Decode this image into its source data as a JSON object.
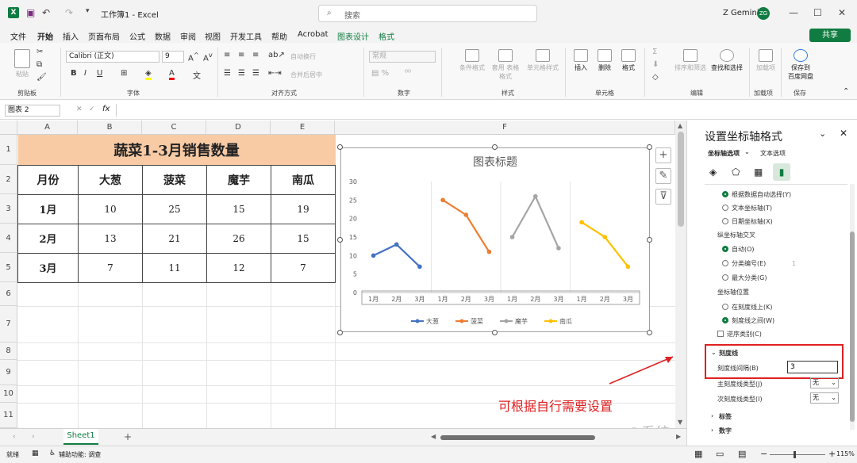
{
  "titlebar": {
    "file_title": "工作簿1 - Excel",
    "search": "搜索",
    "user": "Z Gemini",
    "avatar": "ZG"
  },
  "menu": [
    "文件",
    "开始",
    "插入",
    "页面布局",
    "公式",
    "数据",
    "审阅",
    "视图",
    "开发工具",
    "帮助",
    "Acrobat",
    "图表设计",
    "格式"
  ],
  "share": "共享",
  "ribbon": {
    "paste": "粘贴",
    "font_name": "Calibri (正文)",
    "font_size": "9",
    "wrap": "自动换行",
    "merge": "合并后居中",
    "numfmt": "常规",
    "cond": "条件格式",
    "tablefmt": "套用\n表格格式",
    "cellstyle": "单元格样式",
    "insert": "插入",
    "delete": "删除",
    "format": "格式",
    "sortfilter": "排序和筛选",
    "findsel": "查找和选择",
    "addin": "加载项",
    "save1": "保存到",
    "save2": "百度网盘",
    "groups": [
      "剪贴板",
      "字体",
      "对齐方式",
      "数字",
      "样式",
      "单元格",
      "编辑",
      "加载项",
      "保存"
    ]
  },
  "formula": {
    "name": "图表 2",
    "fx": "fx"
  },
  "columns": [
    "A",
    "B",
    "C",
    "D",
    "E",
    "F"
  ],
  "rows": [
    "1",
    "2",
    "3",
    "4",
    "5",
    "6",
    "7",
    "8",
    "9",
    "10",
    "11"
  ],
  "table": {
    "title": "蔬菜1-3月销售数量",
    "headers": [
      "月份",
      "大葱",
      "菠菜",
      "魔芋",
      "南瓜"
    ],
    "data": [
      [
        "1月",
        "10",
        "25",
        "15",
        "19"
      ],
      [
        "2月",
        "13",
        "21",
        "26",
        "15"
      ],
      [
        "3月",
        "7",
        "11",
        "12",
        "7"
      ]
    ]
  },
  "chart_data": {
    "type": "line",
    "title": "图表标题",
    "categories": [
      "1月",
      "2月",
      "3月"
    ],
    "ylim": [
      0,
      30
    ],
    "yticks": [
      "0",
      "5",
      "10",
      "15",
      "20",
      "25",
      "30"
    ],
    "series": [
      {
        "name": "大葱",
        "values": [
          10,
          13,
          7
        ],
        "color": "#4472c4"
      },
      {
        "name": "菠菜",
        "values": [
          25,
          21,
          11
        ],
        "color": "#ed7d31"
      },
      {
        "name": "魔芋",
        "values": [
          15,
          26,
          12
        ],
        "color": "#a5a5a5"
      },
      {
        "name": "南瓜",
        "values": [
          19,
          15,
          7
        ],
        "color": "#ffc000"
      }
    ]
  },
  "sheet": {
    "tab": "Sheet1",
    "add": "+"
  },
  "status": {
    "ready": "就绪",
    "access": "辅助功能: 调查",
    "zoom": "115%"
  },
  "pane": {
    "title": "设置坐标轴格式",
    "tab1": "坐标轴选项",
    "tab2": "文本选项",
    "o1": "根据数据自动选择(Y)",
    "o2": "文本坐标轴(T)",
    "o3": "日期坐标轴(X)",
    "cross_h": "纵坐标轴交叉",
    "c1": "自动(O)",
    "c2": "分类编号(E)",
    "c2v": "1",
    "c3": "最大分类(G)",
    "pos_h": "坐标轴位置",
    "p1": "在刻度线上(K)",
    "p2": "刻度线之间(W)",
    "rev": "逆序类别(C)",
    "tick_h": "刻度线",
    "interval_lbl": "刻度线间隔(B)",
    "interval_val": "3",
    "major": "主刻度线类型(J)",
    "minor": "次刻度线类型(I)",
    "none": "无",
    "labels": "标签",
    "nums": "数字"
  },
  "annotation": "可根据自行需要设置",
  "watermark": "@系统正在升级ing"
}
